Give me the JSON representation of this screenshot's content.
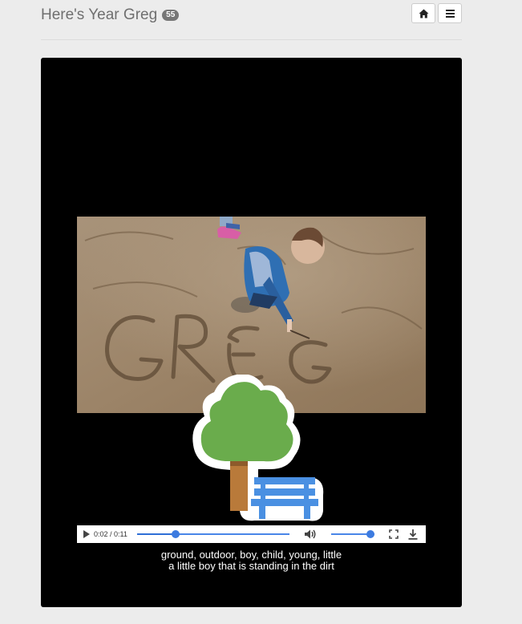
{
  "header": {
    "title": "Here's Year Greg",
    "badge": "55",
    "home_icon": "home-icon",
    "menu_icon": "hamburger-menu-icon"
  },
  "media": {
    "photo_alt": "GREG",
    "overlay_icon": "park-tree-bench-icon"
  },
  "player": {
    "time": "0:02 / 0:11",
    "progress": 0.25,
    "volume": 0.9
  },
  "caption": {
    "tags": "ground, outdoor, boy, child, young, little",
    "description": "a little boy that is standing in the dirt"
  }
}
